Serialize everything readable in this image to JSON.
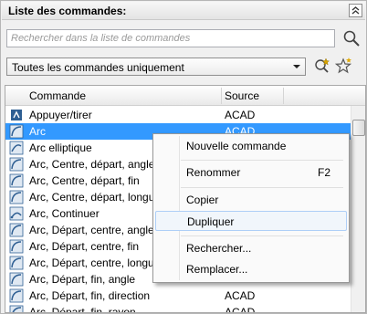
{
  "panel": {
    "title": "Liste des commandes:"
  },
  "search": {
    "placeholder": "Rechercher dans la liste de commandes"
  },
  "filter": {
    "selected": "Toutes les commandes uniquement"
  },
  "list": {
    "columns": [
      "Commande",
      "Source"
    ],
    "rows": [
      {
        "name": "Appuyer/tirer",
        "source": "ACAD",
        "icon": "pushpull-icon"
      },
      {
        "name": "Arc",
        "source": "ACAD",
        "icon": "arc-icon",
        "selected": true
      },
      {
        "name": "Arc elliptique",
        "source": "",
        "icon": "elliptical-arc-icon"
      },
      {
        "name": "Arc, Centre, départ, angle",
        "source": "",
        "icon": "arc-icon"
      },
      {
        "name": "Arc, Centre, départ, fin",
        "source": "",
        "icon": "arc-icon"
      },
      {
        "name": "Arc, Centre, départ, longueur",
        "source": "",
        "icon": "arc-icon"
      },
      {
        "name": "Arc, Continuer",
        "source": "",
        "icon": "arc-continue-icon"
      },
      {
        "name": "Arc, Départ, centre, angle",
        "source": "",
        "icon": "arc-icon"
      },
      {
        "name": "Arc, Départ, centre, fin",
        "source": "",
        "icon": "arc-icon"
      },
      {
        "name": "Arc, Départ, centre, longueur",
        "source": "",
        "icon": "arc-icon"
      },
      {
        "name": "Arc, Départ, fin, angle",
        "source": "",
        "icon": "arc-icon"
      },
      {
        "name": "Arc, Départ, fin, direction",
        "source": "ACAD",
        "icon": "arc-icon"
      },
      {
        "name": "Arc, Départ, fin, rayon",
        "source": "ACAD",
        "icon": "arc-icon"
      }
    ]
  },
  "context_menu": {
    "items": [
      {
        "label": "Nouvelle commande",
        "shortcut": ""
      },
      {
        "label": "Renommer",
        "shortcut": "F2"
      },
      {
        "label": "Copier",
        "shortcut": ""
      },
      {
        "label": "Dupliquer",
        "shortcut": "",
        "hover": true
      },
      {
        "label": "Rechercher...",
        "shortcut": ""
      },
      {
        "label": "Remplacer...",
        "shortcut": ""
      }
    ]
  },
  "colors": {
    "selection": "#3399ff",
    "icon_blue": "#2f5f93"
  }
}
